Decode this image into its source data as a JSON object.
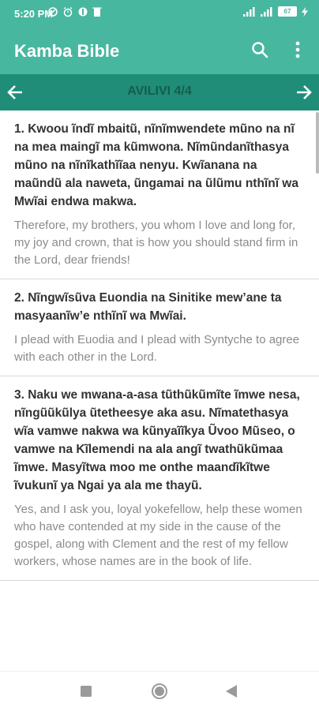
{
  "status": {
    "time": "5:20 PM",
    "battery": "67"
  },
  "app": {
    "title": "Kamba Bible",
    "search_icon": "search-icon",
    "menu_icon": "more-vertical-icon"
  },
  "nav": {
    "title": "AVILIVI 4/4",
    "prev_icon": "arrow-left-icon",
    "next_icon": "arrow-right-icon"
  },
  "verses": [
    {
      "kamba": "1. Kwoou ĩndĩ mbaitũ, nĩnĩmwendete mũno na nĩ na mea maingĩ ma kũmwona. Nĩmũndanĩthasya mũno na nĩnĩkathĩĩaa nenyu. Kwĩanana na maũndũ ala naweta, ũngamai na ũlũmu nthĩnĩ wa Mwĩai endwa makwa.",
      "english": "Therefore, my brothers, you whom I love and long for, my joy and crown, that is how you should stand firm in the Lord, dear friends!"
    },
    {
      "kamba": "2. Nĩngwĩsũva Euondia na Sinitike mew’ane ta masyaanĩw’e nthĩnĩ wa Mwĩai.",
      "english": "I plead with Euodia and I plead with Syntyche to agree with each other in the Lord."
    },
    {
      "kamba": "3. Naku we mwana-a-asa tũthũkũmĩte ĩmwe nesa, nĩngũũkũlya ũtetheesye aka asu. Nĩmatethasya wĩa vamwe nakwa wa kũnyaĩĩkya Ũvoo Mũseo, o vamwe na Kĩlemendi na ala angĩ twathũkũmaa ĩmwe. Masyĩtwa moo me onthe maandĩkĩtwe ĩvukunĩ ya Ngai ya ala me thayũ.",
      "english": "Yes, and I ask you, loyal yokefellow, help these women who have contended at my side in the cause of the gospel, along with Clement and the rest of my fellow workers, whose names are in the book of life."
    }
  ],
  "system_nav": {
    "recents": "square-icon",
    "home": "circle-icon",
    "back": "triangle-back-icon"
  },
  "colors": {
    "primary": "#48b79f",
    "primary_dark": "#1f8d78"
  }
}
